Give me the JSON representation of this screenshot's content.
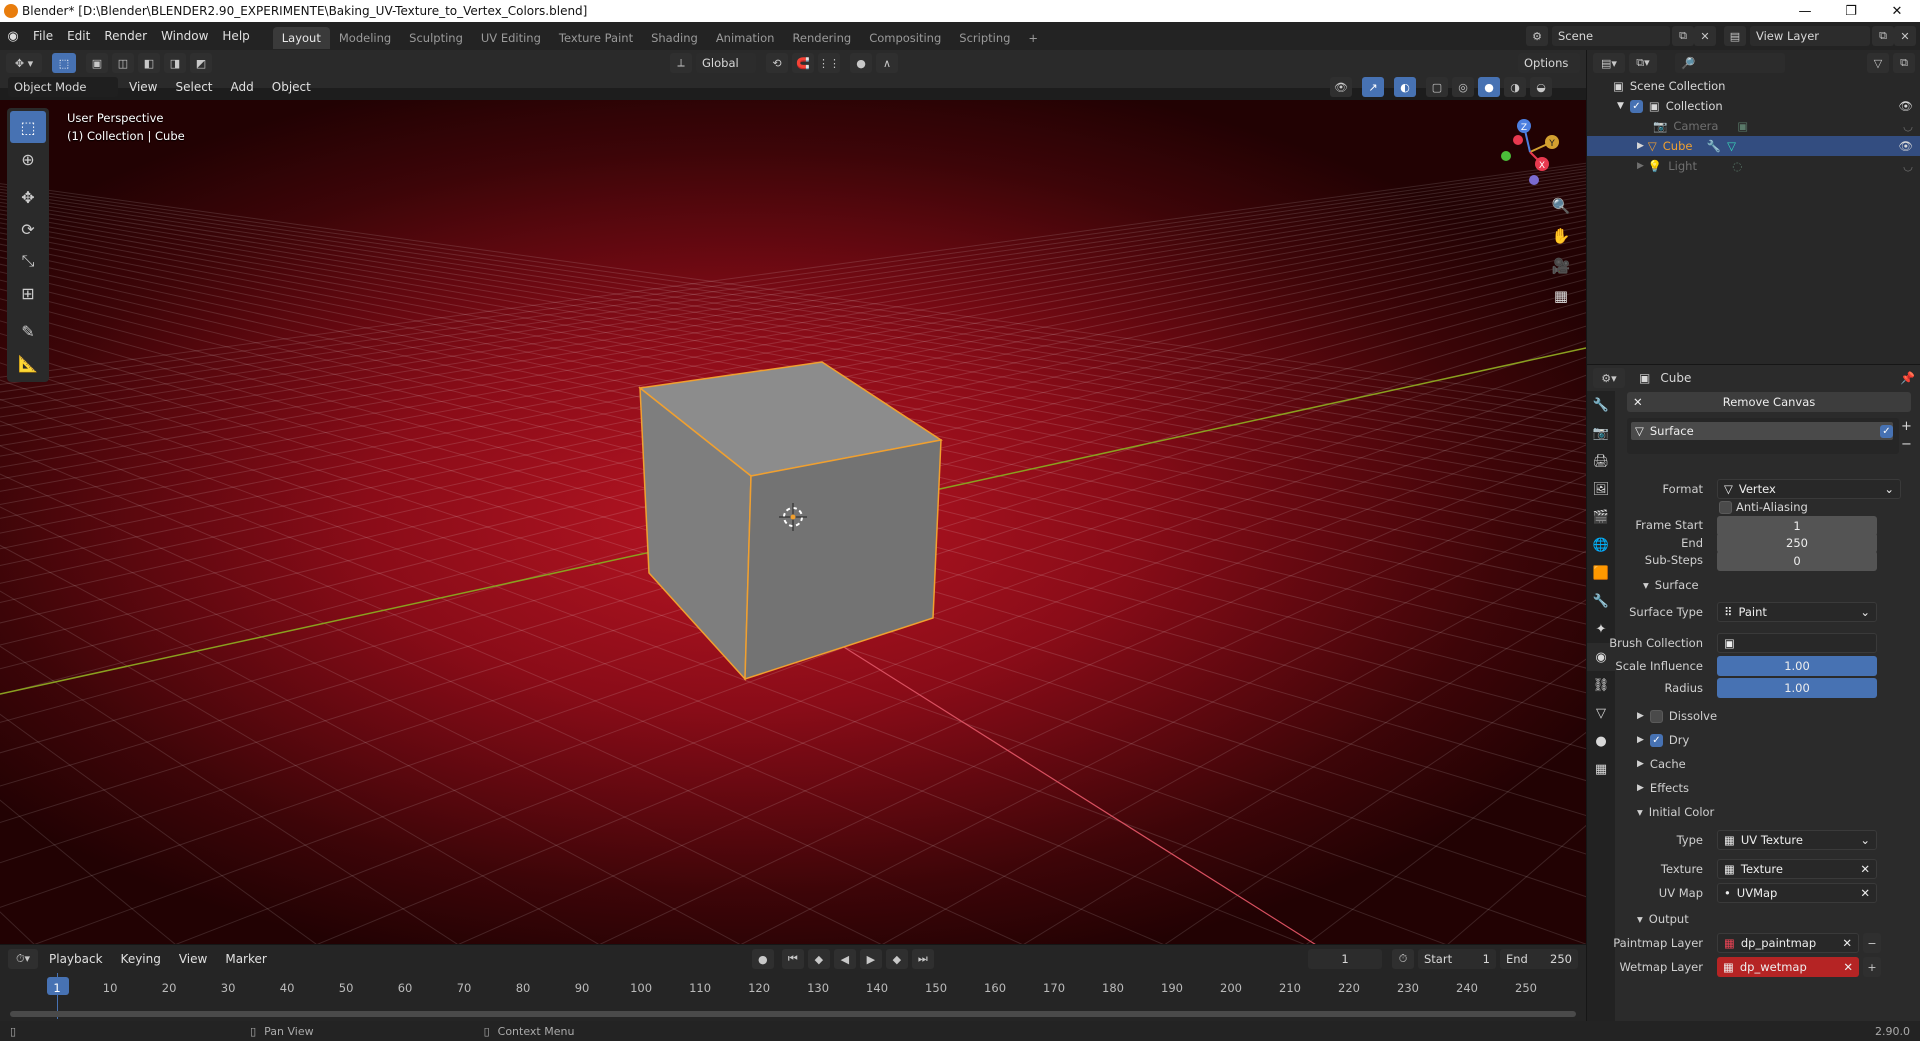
{
  "window": {
    "title": "Blender* [D:\\Blender\\BLENDER2.90_EXPERIMENTE\\Baking_UV-Texture_to_Vertex_Colors.blend]",
    "minimize": "—",
    "maximize": "❐",
    "close": "✕"
  },
  "menus": [
    "File",
    "Edit",
    "Render",
    "Window",
    "Help"
  ],
  "workspaces": [
    "Layout",
    "Modeling",
    "Sculpting",
    "UV Editing",
    "Texture Paint",
    "Shading",
    "Animation",
    "Rendering",
    "Compositing",
    "Scripting"
  ],
  "active_workspace": "Layout",
  "add_workspace": "+",
  "scene": {
    "label": "Scene",
    "view_layer": "View Layer"
  },
  "viewport_header": {
    "transform_orientation": "Global",
    "options": "Options",
    "mode": "Object Mode",
    "menus": [
      "View",
      "Select",
      "Add",
      "Object"
    ]
  },
  "viewport": {
    "perspective": "User Perspective",
    "collection_info": "(1) Collection | Cube"
  },
  "gizmo": {
    "x": "X",
    "y": "Y",
    "z": "Z"
  },
  "outliner": {
    "root": "Scene Collection",
    "items": [
      {
        "name": "Collection"
      },
      {
        "name": "Camera"
      },
      {
        "name": "Cube"
      },
      {
        "name": "Light"
      }
    ]
  },
  "properties": {
    "object_name": "Cube",
    "remove_canvas": "Remove Canvas",
    "surface_slot": "Surface",
    "format_label": "Format",
    "format_value": "Vertex",
    "anti_aliasing": "Anti-Aliasing",
    "frame_start_label": "Frame Start",
    "frame_start": "1",
    "end_label": "End",
    "end": "250",
    "substeps_label": "Sub-Steps",
    "substeps": "0",
    "surface_section": "Surface",
    "surface_type_label": "Surface Type",
    "surface_type": "Paint",
    "brush_collection_label": "Brush Collection",
    "scale_influence_label": "Scale Influence",
    "scale_influence": "1.00",
    "radius_label": "Radius",
    "radius": "1.00",
    "dissolve": "Dissolve",
    "dry": "Dry",
    "cache": "Cache",
    "effects": "Effects",
    "initial_color": "Initial Color",
    "type_label": "Type",
    "type_value": "UV Texture",
    "texture_label": "Texture",
    "texture_value": "Texture",
    "uvmap_label": "UV Map",
    "uvmap_value": "UVMap",
    "output": "Output",
    "paintmap_label": "Paintmap Layer",
    "paintmap_value": "dp_paintmap",
    "wetmap_label": "Wetmap Layer",
    "wetmap_value": "dp_wetmap"
  },
  "timeline": {
    "menus": [
      "Playback",
      "Keying",
      "View",
      "Marker"
    ],
    "current_frame": "1",
    "start_label": "Start",
    "start": "1",
    "end_label": "End",
    "end": "250",
    "ticks": [
      "1",
      "10",
      "20",
      "30",
      "40",
      "50",
      "60",
      "70",
      "80",
      "90",
      "100",
      "110",
      "120",
      "130",
      "140",
      "150",
      "160",
      "170",
      "180",
      "190",
      "200",
      "210",
      "220",
      "230",
      "240",
      "250"
    ]
  },
  "status": {
    "pan": "Pan View",
    "context": "Context Menu",
    "version": "2.90.0"
  },
  "colors": {
    "accent": "#4772b3",
    "selection_outline": "#f0a030",
    "viewport_bg": "#b81523",
    "red_field": "#b52424"
  }
}
